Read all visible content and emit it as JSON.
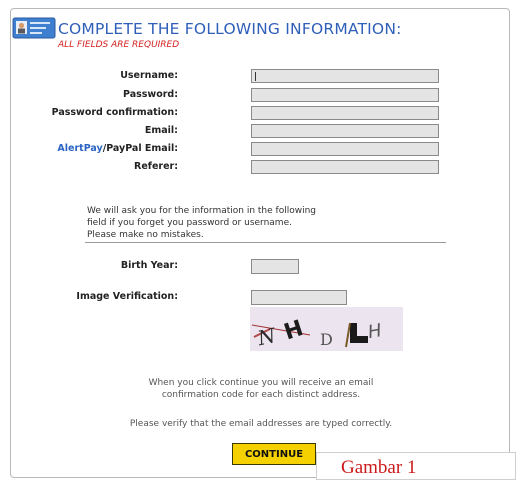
{
  "header": {
    "title": "COMPLETE THE FOLLOWING INFORMATION:",
    "subtitle": "ALL FIELDS ARE REQUIRED",
    "icon": "id-card-icon"
  },
  "fields": {
    "username_label": "Username:",
    "password_label": "Password:",
    "password_confirm_label": "Password confirmation:",
    "email_label": "Email:",
    "alertpay_label": "AlertPay",
    "paypal_label": "/PayPal Email:",
    "referer_label": "Referer:"
  },
  "note": {
    "line1": "We will ask you for the information in the following",
    "line2": "field if you forget you password or username.",
    "line3": "Please make no mistakes."
  },
  "birth_year_label": "Birth Year:",
  "image_verification_label": "Image Verification:",
  "captcha_text": "NH D LH",
  "confirm_info": {
    "line1": "When you click continue you will receive an email",
    "line2": "confirmation code for each distinct address.",
    "line3": "Please verify that the email addresses are typed correctly."
  },
  "continue_label": "CONTINUE",
  "figure_caption": "Gambar 1",
  "colors": {
    "title": "#2f5fb8",
    "required": "#d31f1f",
    "button": "#f5d100",
    "caption": "#cc1a1a"
  }
}
